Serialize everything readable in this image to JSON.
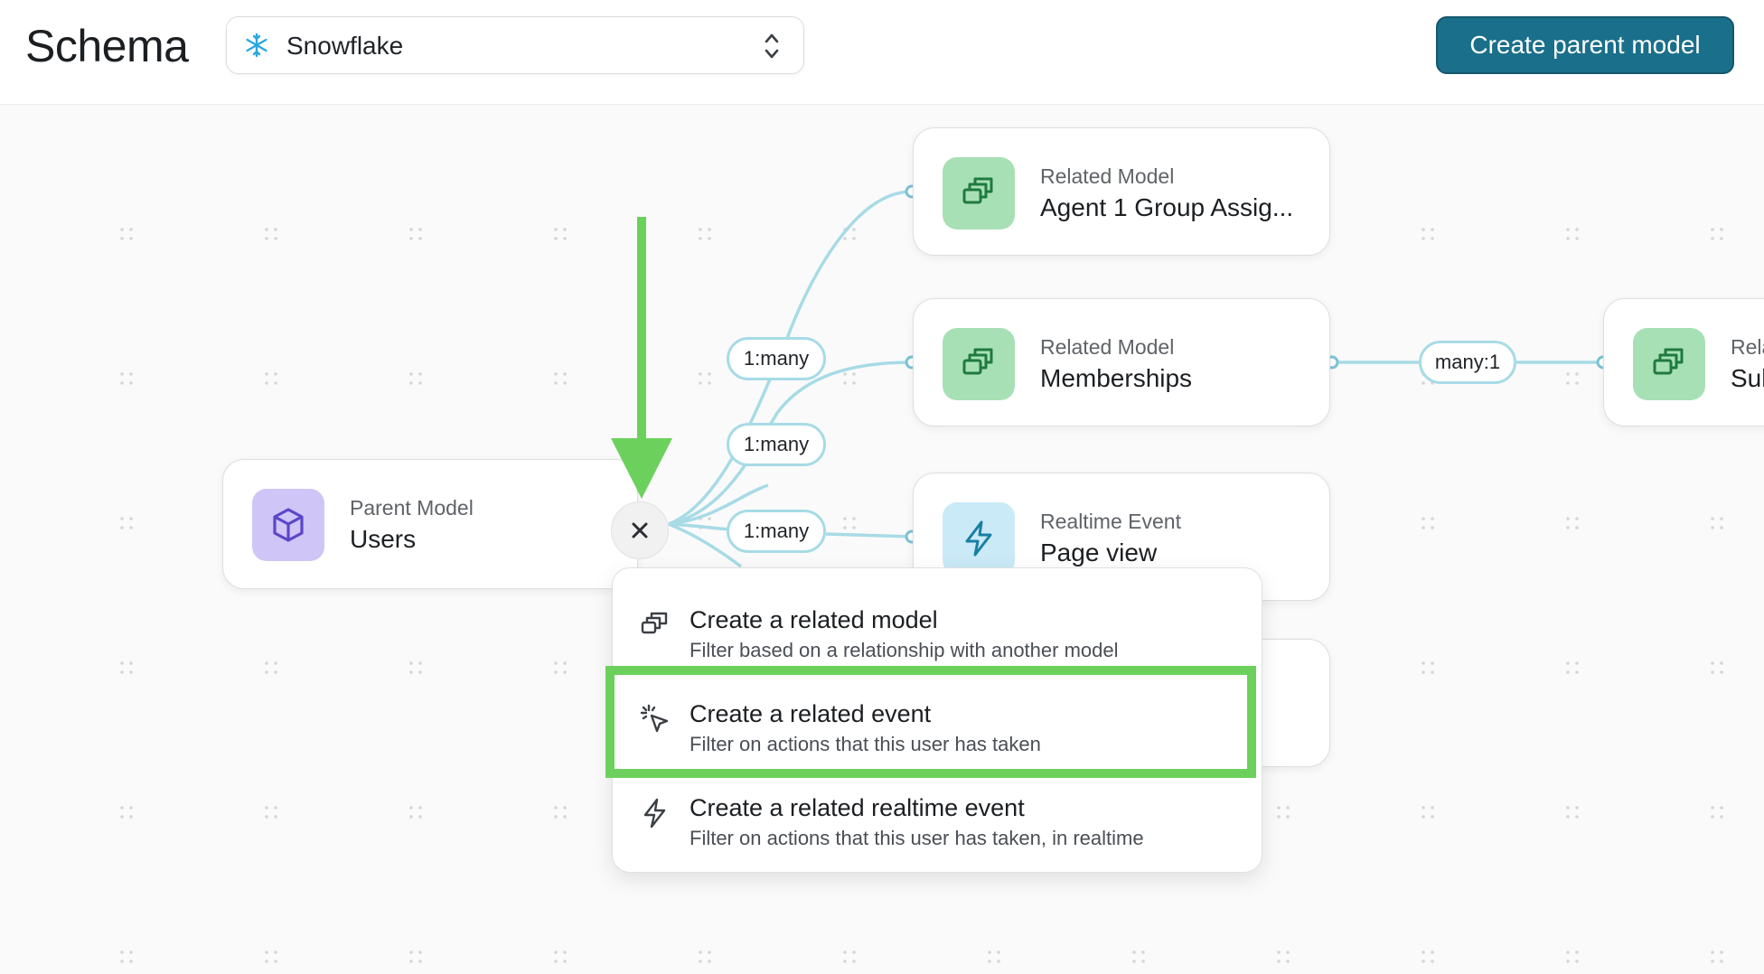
{
  "header": {
    "title": "Schema",
    "source": "Snowflake",
    "create_button": "Create parent model"
  },
  "nodes": {
    "parent": {
      "kind": "Parent Model",
      "name": "Users"
    },
    "related1": {
      "kind": "Related Model",
      "name": "Agent 1 Group Assig..."
    },
    "related2": {
      "kind": "Related Model",
      "name": "Memberships"
    },
    "realtime": {
      "kind": "Realtime Event",
      "name": "Page view"
    },
    "far_right": {
      "kind": "Rela",
      "name": "Sub"
    }
  },
  "edges": {
    "e1": "1:many",
    "e2": "1:many",
    "e3": "1:many",
    "e4": "many:1"
  },
  "menu": {
    "items": [
      {
        "title": "Create a related model",
        "desc": "Filter based on a relationship with another model"
      },
      {
        "title": "Create a related event",
        "desc": "Filter on actions that this user has taken"
      },
      {
        "title": "Create a related realtime event",
        "desc": "Filter on actions that this user has taken, in realtime"
      }
    ]
  },
  "colors": {
    "brand": "#1a6f8a",
    "edge": "#8fcfdf",
    "highlight": "#6cd15c",
    "related_icon_bg": "#a8e0b6",
    "parent_icon_bg": "#cfc5f7",
    "event_icon_bg": "#c9eaf6"
  }
}
